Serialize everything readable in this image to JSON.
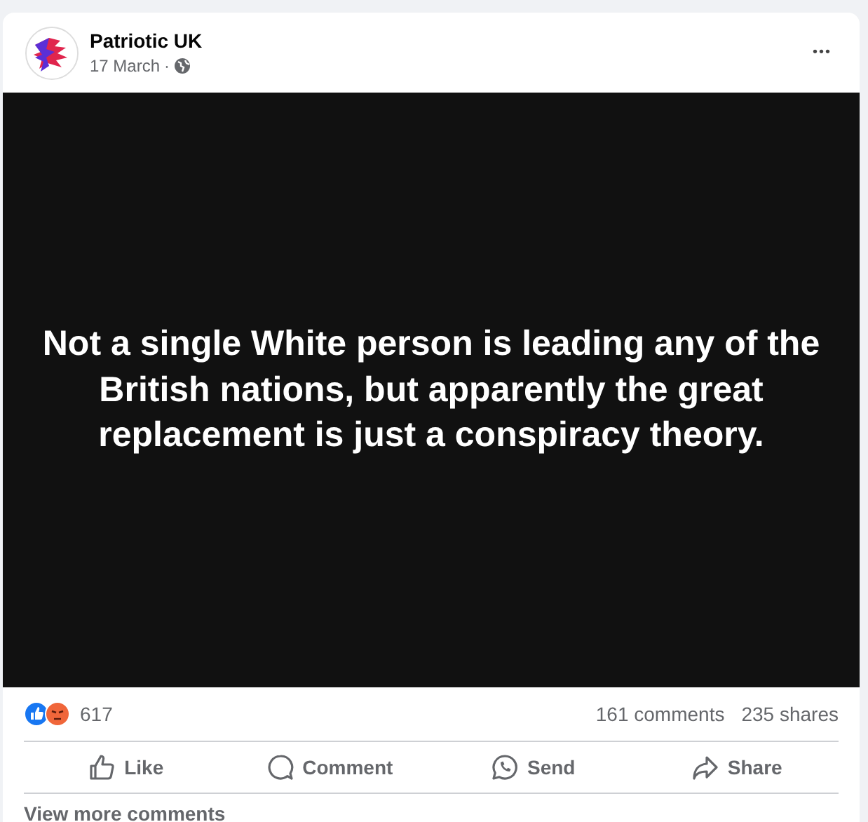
{
  "post": {
    "author": "Patriotic UK",
    "date": "17 March",
    "separator": "·",
    "menu": "•••",
    "image_text": "Not a single White person is leading any of the British nations, but apparently the great replacement is just a conspiracy theory."
  },
  "stats": {
    "reactions": [
      {
        "kind": "like"
      },
      {
        "kind": "angry"
      }
    ],
    "reaction_count": "617",
    "comments": "161 comments",
    "shares": "235 shares"
  },
  "actions": [
    {
      "kind": "like",
      "label": "Like"
    },
    {
      "kind": "comment",
      "label": "Comment"
    },
    {
      "kind": "send",
      "label": "Send"
    },
    {
      "kind": "share",
      "label": "Share"
    }
  ],
  "comments_link": "View more comments"
}
